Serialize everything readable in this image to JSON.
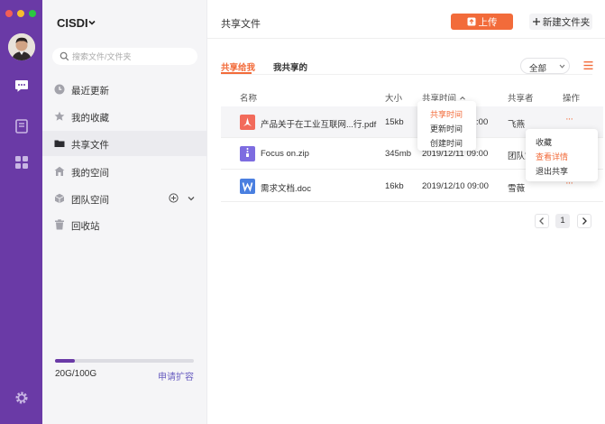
{
  "rail": {
    "traffic_colors": [
      "#f25e56",
      "#f7bd2e",
      "#2bc840"
    ],
    "icons": [
      "chat-bubble-icon",
      "notebook-icon",
      "apps-grid-icon",
      "settings-gear-icon"
    ],
    "accent": "#6a3aa6"
  },
  "sidebar": {
    "brand": "CISDI",
    "search_placeholder": "搜索文件/文件夹",
    "items": [
      {
        "label": "最近更新",
        "icon": "clock-icon"
      },
      {
        "label": "我的收藏",
        "icon": "star-icon"
      },
      {
        "label": "共享文件",
        "icon": "folder-icon",
        "active": true
      },
      {
        "label": "我的空间",
        "icon": "home-icon"
      },
      {
        "label": "团队空间",
        "icon": "cube-icon"
      },
      {
        "label": "回收站",
        "icon": "trash-icon"
      }
    ],
    "storage": {
      "used_text": "20G/100G",
      "used_fraction": 0.14,
      "expand_link": "申请扩容"
    }
  },
  "main": {
    "title": "共享文件",
    "upload_label": "上传",
    "new_folder_label": "新建文件夹",
    "tabs": [
      {
        "label": "共享给我",
        "active": true
      },
      {
        "label": "我共享的",
        "active": false
      }
    ],
    "filter_value": "全部",
    "table": {
      "headers": {
        "name": "名称",
        "size": "大小",
        "time": "共享时间",
        "sharer": "共享者",
        "actions": "操作"
      },
      "rows": [
        {
          "icon": "pdf-file-icon",
          "icon_color": "#f26b5b",
          "name": "产品关于在工业互联网...行.pdf",
          "size": "15kb",
          "time": "2019/12/11 09:00",
          "sharer": "飞燕",
          "more": "···"
        },
        {
          "icon": "zip-file-icon",
          "icon_color": "#7d6ce0",
          "name": "Focus on.zip",
          "size": "345mb",
          "time": "2019/12/11 09:00",
          "sharer": "团队空间",
          "more": "···"
        },
        {
          "icon": "word-file-icon",
          "icon_color": "#4a7fe0",
          "name": "需求文档.doc",
          "size": "16kb",
          "time": "2019/12/10 09:00",
          "sharer": "雪薇",
          "more": "···"
        }
      ]
    },
    "sort_menu": {
      "items": [
        "共享时间",
        "更新时间",
        "创建时间"
      ],
      "active_index": 0
    },
    "action_menu": {
      "items": [
        "收藏",
        "查看详情",
        "退出共享"
      ],
      "active_index": 1
    },
    "pager": {
      "current": "1"
    },
    "accent": "#f26b3a"
  }
}
